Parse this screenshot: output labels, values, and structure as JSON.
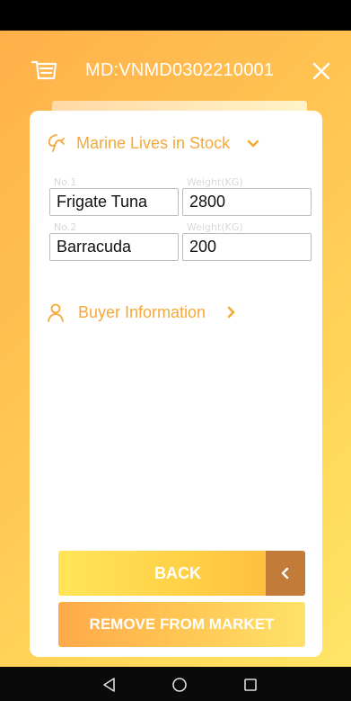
{
  "header": {
    "title": "MD:VNMD0302210001",
    "left_icon": "cart-icon",
    "right_icon": "close-icon"
  },
  "marine_section": {
    "title": "Marine Lives in Stock",
    "icon": "fish-icon",
    "rows": [
      {
        "no_label": "No.1",
        "weight_label": "Weight(KG)",
        "name": "Frigate Tuna",
        "weight": "2800"
      },
      {
        "no_label": "No.2",
        "weight_label": "Weight(KG)",
        "name": "Barracuda",
        "weight": "200"
      }
    ]
  },
  "buyer_section": {
    "title": "Buyer Information",
    "icon": "person-icon"
  },
  "buttons": {
    "back": "BACK",
    "remove": "REMOVE FROM MARKET"
  },
  "colors": {
    "accent": "#f7a838",
    "back_arrow_bg": "#c27b38"
  }
}
